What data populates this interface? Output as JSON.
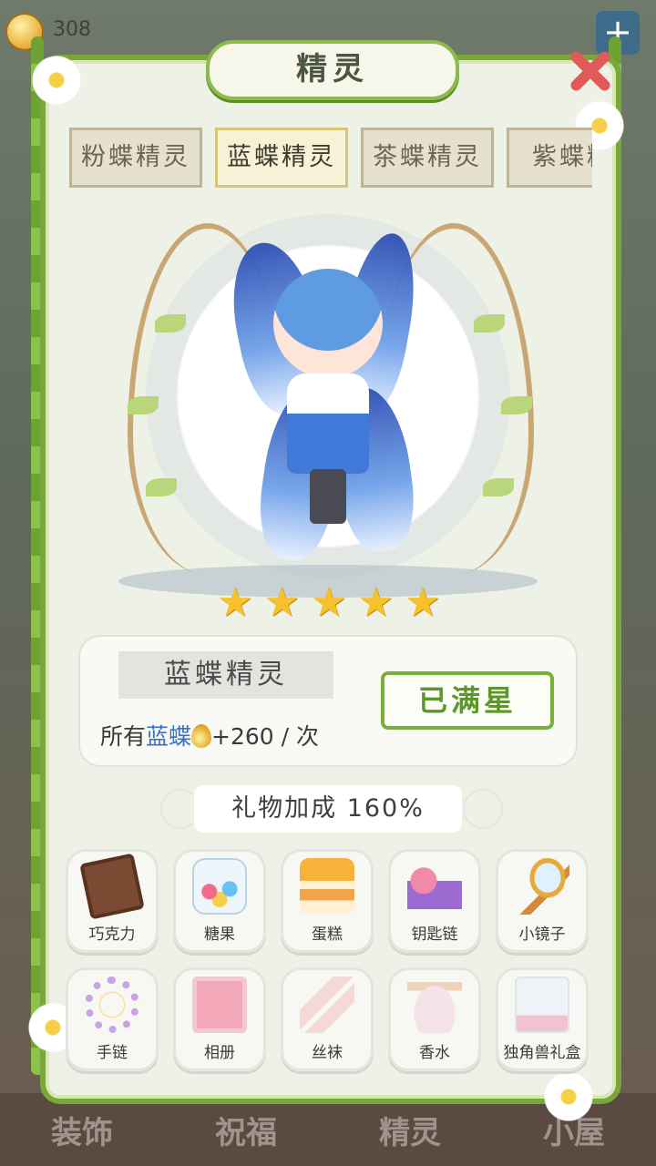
{
  "hud": {
    "coin_value": "308",
    "plus_label": "+"
  },
  "modal": {
    "title": "精灵"
  },
  "tabs": [
    "粉蝶精灵",
    "蓝蝶精灵",
    "茶蝶精灵",
    "紫蝶精"
  ],
  "active_tab_index": 1,
  "hero": {
    "star_count": 5,
    "stars": [
      "★",
      "★",
      "★",
      "★",
      "★"
    ]
  },
  "info": {
    "name": "蓝蝶精灵",
    "bonus_prefix": "所有",
    "bonus_target": "蓝蝶",
    "bonus_value": "+260",
    "bonus_unit": "/ 次",
    "max_button": "已满星"
  },
  "gift_bonus": "礼物加成 160%",
  "gifts": [
    {
      "label": "巧克力",
      "icon": "chocolate-icon"
    },
    {
      "label": "糖果",
      "icon": "candy-jar-icon"
    },
    {
      "label": "蛋糕",
      "icon": "cake-icon"
    },
    {
      "label": "钥匙链",
      "icon": "keychain-icon"
    },
    {
      "label": "小镜子",
      "icon": "mirror-icon"
    },
    {
      "label": "手链",
      "icon": "bracelet-icon"
    },
    {
      "label": "相册",
      "icon": "photo-album-icon"
    },
    {
      "label": "丝袜",
      "icon": "stockings-icon"
    },
    {
      "label": "香水",
      "icon": "perfume-icon"
    },
    {
      "label": "独角兽礼盒",
      "icon": "unicorn-gift-box-icon"
    }
  ],
  "bottom_nav": [
    "装饰",
    "祝福",
    "精灵",
    "小屋"
  ],
  "colors": {
    "accent_green": "#78b03a",
    "star_gold": "#f6c12a",
    "blue_text": "#3c6fc6"
  }
}
